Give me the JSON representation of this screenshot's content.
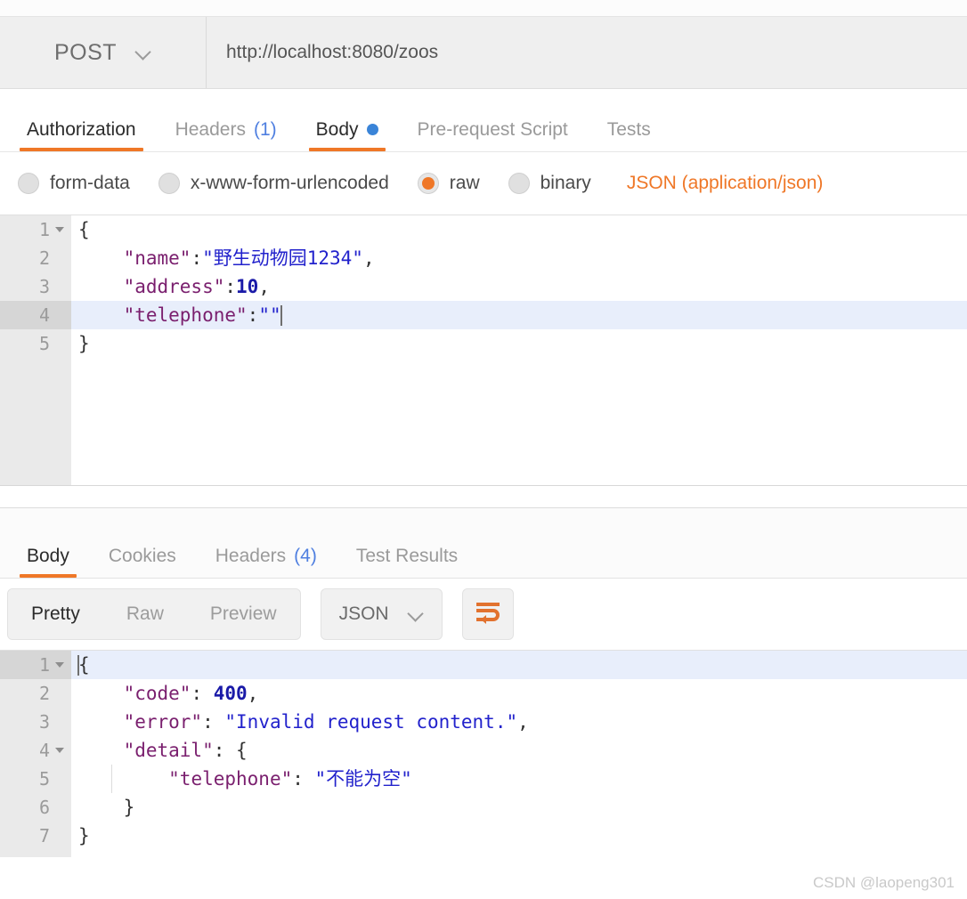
{
  "request": {
    "method": "POST",
    "method_chevron_icon": "chevron-down-icon",
    "url": "http://localhost:8080/zoos",
    "tabs": [
      {
        "label": "Authorization",
        "count": "",
        "active": false,
        "dot": false
      },
      {
        "label": "Headers",
        "count": "(1)",
        "active": false,
        "dot": false
      },
      {
        "label": "Body",
        "count": "",
        "active": true,
        "dot": true
      },
      {
        "label": "Pre-request Script",
        "count": "",
        "active": false,
        "dot": false
      },
      {
        "label": "Tests",
        "count": "",
        "active": false,
        "dot": false
      }
    ],
    "body_types": [
      {
        "label": "form-data",
        "selected": false
      },
      {
        "label": "x-www-form-urlencoded",
        "selected": false
      },
      {
        "label": "raw",
        "selected": true
      },
      {
        "label": "binary",
        "selected": false
      }
    ],
    "content_type": "JSON (application/json)",
    "editor": {
      "active_line": 4,
      "lines": [
        {
          "num": "1",
          "fold": true,
          "active": false
        },
        {
          "num": "2",
          "fold": false,
          "active": false
        },
        {
          "num": "3",
          "fold": false,
          "active": false
        },
        {
          "num": "4",
          "fold": false,
          "active": true
        },
        {
          "num": "5",
          "fold": false,
          "active": false
        }
      ],
      "text": {
        "l1_brace": "{",
        "l2_key": "\"name\"",
        "l2_colon": ":",
        "l2_val": "\"野生动物园1234\"",
        "l2_comma": ",",
        "l3_key": "\"address\"",
        "l3_colon": ":",
        "l3_val": "10",
        "l3_comma": ",",
        "l4_key": "\"telephone\"",
        "l4_colon": ":",
        "l4_val": "\"\"",
        "l5_brace": "}"
      }
    }
  },
  "response": {
    "tabs": [
      {
        "label": "Body",
        "count": "",
        "active": true
      },
      {
        "label": "Cookies",
        "count": "",
        "active": false
      },
      {
        "label": "Headers",
        "count": "(4)",
        "active": false
      },
      {
        "label": "Test Results",
        "count": "",
        "active": false
      }
    ],
    "view_modes": [
      {
        "label": "Pretty",
        "active": true
      },
      {
        "label": "Raw",
        "active": false
      },
      {
        "label": "Preview",
        "active": false
      }
    ],
    "format": "JSON",
    "format_chevron_icon": "chevron-down-icon",
    "wrap_button_icon": "word-wrap-icon",
    "editor": {
      "active_line": 1,
      "lines": [
        {
          "num": "1",
          "fold": true,
          "active": true
        },
        {
          "num": "2",
          "fold": false,
          "active": false
        },
        {
          "num": "3",
          "fold": false,
          "active": false
        },
        {
          "num": "4",
          "fold": true,
          "active": false
        },
        {
          "num": "5",
          "fold": false,
          "active": false
        },
        {
          "num": "6",
          "fold": false,
          "active": false
        },
        {
          "num": "7",
          "fold": false,
          "active": false
        }
      ],
      "text": {
        "l1_brace": "{",
        "l2_key": "\"code\"",
        "l2_colon": ": ",
        "l2_val": "400",
        "l2_comma": ",",
        "l3_key": "\"error\"",
        "l3_colon": ": ",
        "l3_val": "\"Invalid request content.\"",
        "l3_comma": ",",
        "l4_key": "\"detail\"",
        "l4_colon": ": ",
        "l4_brace": "{",
        "l5_key": "\"telephone\"",
        "l5_colon": ": ",
        "l5_val": "\"不能为空\"",
        "l6_brace": "}",
        "l7_brace": "}"
      }
    }
  },
  "watermark": "CSDN @laopeng301",
  "colors": {
    "accent_orange": "#ef7727",
    "link_blue": "#4f7fe0",
    "json_key": "#7a1f6e",
    "json_string": "#2222cc",
    "json_number": "#1a1aa8",
    "active_line": "#e8eefb"
  }
}
